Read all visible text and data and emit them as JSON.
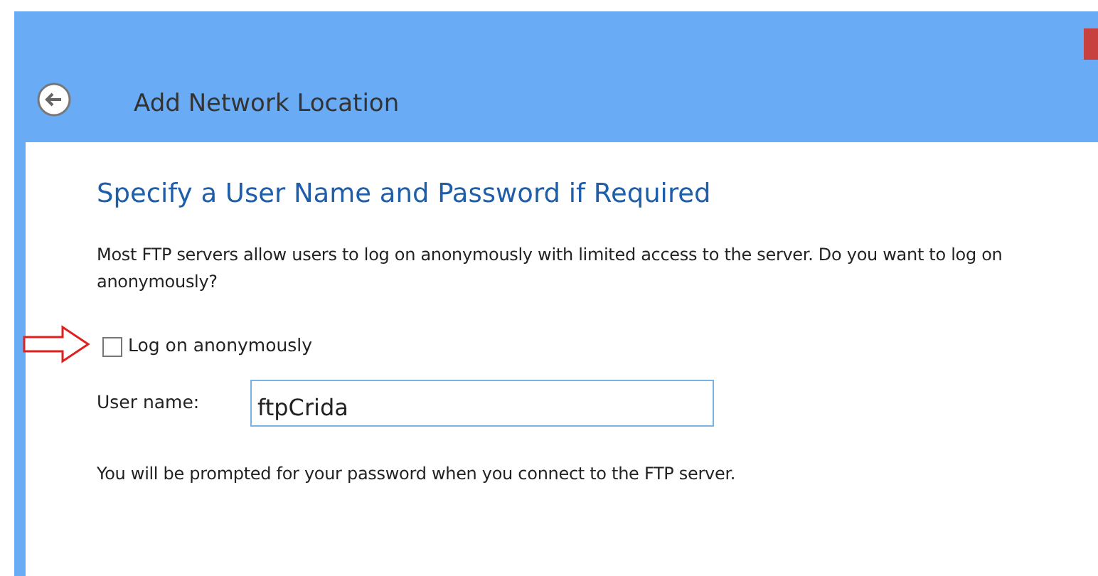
{
  "window": {
    "title": "Add Network Location"
  },
  "heading": "Specify a User Name and Password if Required",
  "description": "Most FTP servers allow users to log on anonymously with limited access to the server.  Do you want to log on anonymously?",
  "anonymous": {
    "label": "Log on anonymously",
    "checked": false
  },
  "username": {
    "label": "User name:",
    "value": "ftpCrida"
  },
  "note": "You will be prompted for your password when you connect to the FTP server."
}
